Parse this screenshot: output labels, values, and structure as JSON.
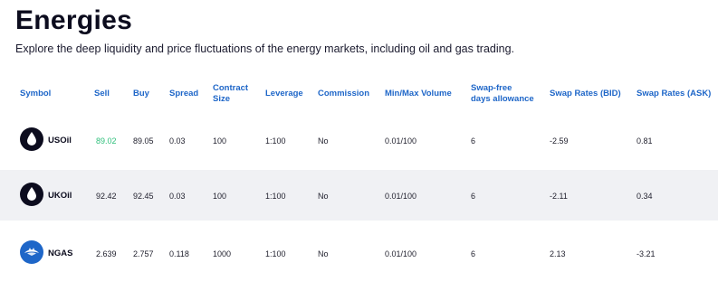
{
  "page": {
    "title": "Energies",
    "subtitle": "Explore the deep liquidity and price fluctuations of the energy markets, including oil and gas trading."
  },
  "table": {
    "headers": {
      "symbol": "Symbol",
      "sell": "Sell",
      "buy": "Buy",
      "spread": "Spread",
      "contract_size_1": "Contract",
      "contract_size_2": "Size",
      "leverage": "Leverage",
      "commission": "Commission",
      "minmax": "Min/Max Volume",
      "swapfree_1": "Swap-free",
      "swapfree_2": "days allowance",
      "swap_bid": "Swap Rates (BID)",
      "swap_ask": "Swap Rates (ASK)"
    },
    "rows": [
      {
        "icon": "oil-drop-icon",
        "symbol": "USOil",
        "sell": "89.02",
        "buy": "89.05",
        "spread": "0.03",
        "contract_size": "100",
        "leverage": "1:100",
        "commission": "No",
        "minmax": "0.01/100",
        "swapfree": "6",
        "swap_bid": "-2.59",
        "swap_ask": "0.81"
      },
      {
        "icon": "oil-drop-icon",
        "symbol": "UKOil",
        "sell": "92.42",
        "buy": "92.45",
        "spread": "0.03",
        "contract_size": "100",
        "leverage": "1:100",
        "commission": "No",
        "minmax": "0.01/100",
        "swapfree": "6",
        "swap_bid": "-2.11",
        "swap_ask": "0.34"
      },
      {
        "icon": "gas-flame-icon",
        "symbol": "NGAS",
        "sell": "2.639",
        "buy": "2.757",
        "spread": "0.118",
        "contract_size": "1000",
        "leverage": "1:100",
        "commission": "No",
        "minmax": "0.01/100",
        "swapfree": "6",
        "swap_bid": "2.13",
        "swap_ask": "-3.21"
      }
    ]
  },
  "colors": {
    "header_text": "#1e66c8",
    "sell_highlight": "#2dbf7a",
    "row_shade": "#f0f1f4",
    "oil_icon_bg": "#0c0c1e",
    "gas_icon_bg": "#1e66c8"
  }
}
